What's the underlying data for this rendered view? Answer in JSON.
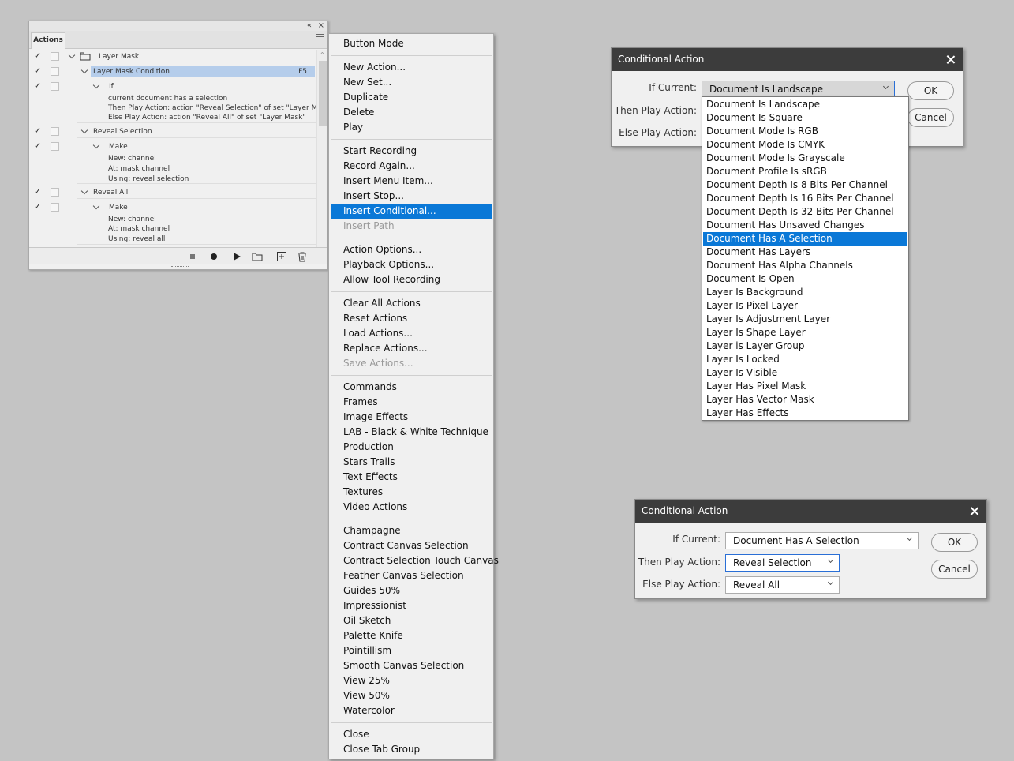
{
  "actions_panel": {
    "tab": "Actions",
    "collapse_glyph": "«",
    "close_glyph": "×",
    "rows": [
      {
        "check": "✓",
        "label": "Layer Mask",
        "icon": "folder-icon"
      },
      {
        "check": "✓",
        "label": "Layer Mask Condition",
        "fkey": "F5",
        "selected": true
      },
      {
        "check": "✓",
        "label": "If"
      },
      {
        "label": "current document has a selection"
      },
      {
        "label": "Then Play Action: action \"Reveal Selection\" of set \"Layer Mask\""
      },
      {
        "label": "Else Play Action: action \"Reveal All\" of set \"Layer Mask\""
      },
      {
        "check": "✓",
        "label": "Reveal Selection"
      },
      {
        "check": "✓",
        "label": "Make"
      },
      {
        "label": "New: channel"
      },
      {
        "label": "At: mask channel"
      },
      {
        "label": "Using: reveal selection"
      },
      {
        "check": "✓",
        "label": "Reveal All"
      },
      {
        "check": "✓",
        "label": "Make"
      },
      {
        "label": "New: channel"
      },
      {
        "label": "At: mask channel"
      },
      {
        "label": "Using: reveal all"
      }
    ],
    "toolbar_icons": [
      "stop-icon",
      "record-icon",
      "play-icon",
      "new-set-icon",
      "new-action-icon",
      "delete-icon"
    ]
  },
  "context_menu": {
    "groups": [
      [
        {
          "label": "Button Mode"
        }
      ],
      [
        {
          "label": "New Action..."
        },
        {
          "label": "New Set..."
        },
        {
          "label": "Duplicate"
        },
        {
          "label": "Delete"
        },
        {
          "label": "Play"
        }
      ],
      [
        {
          "label": "Start Recording"
        },
        {
          "label": "Record Again..."
        },
        {
          "label": "Insert Menu Item..."
        },
        {
          "label": "Insert Stop..."
        },
        {
          "label": "Insert Conditional...",
          "highlighted": true
        },
        {
          "label": "Insert Path",
          "disabled": true
        }
      ],
      [
        {
          "label": "Action Options..."
        },
        {
          "label": "Playback Options..."
        },
        {
          "label": "Allow Tool Recording"
        }
      ],
      [
        {
          "label": "Clear All Actions"
        },
        {
          "label": "Reset Actions"
        },
        {
          "label": "Load Actions..."
        },
        {
          "label": "Replace Actions..."
        },
        {
          "label": "Save Actions...",
          "disabled": true
        }
      ],
      [
        {
          "label": "Commands"
        },
        {
          "label": "Frames"
        },
        {
          "label": "Image Effects"
        },
        {
          "label": "LAB - Black & White Technique"
        },
        {
          "label": "Production"
        },
        {
          "label": "Stars Trails"
        },
        {
          "label": "Text Effects"
        },
        {
          "label": "Textures"
        },
        {
          "label": "Video Actions"
        }
      ],
      [
        {
          "label": "Champagne"
        },
        {
          "label": "Contract Canvas Selection"
        },
        {
          "label": "Contract Selection Touch Canvas"
        },
        {
          "label": "Feather Canvas Selection"
        },
        {
          "label": "Guides 50%"
        },
        {
          "label": "Impressionist"
        },
        {
          "label": "Oil Sketch"
        },
        {
          "label": "Palette Knife"
        },
        {
          "label": "Pointillism"
        },
        {
          "label": "Smooth Canvas Selection"
        },
        {
          "label": "View 25%"
        },
        {
          "label": "View 50%"
        },
        {
          "label": "Watercolor"
        }
      ],
      [
        {
          "label": "Close"
        },
        {
          "label": "Close Tab Group"
        }
      ]
    ]
  },
  "dialog_top": {
    "title": "Conditional Action",
    "if_label": "If Current:",
    "then_label": "Then Play Action:",
    "else_label": "Else Play Action:",
    "if_value": "Document Is Landscape",
    "ok": "OK",
    "cancel": "Cancel",
    "options": [
      "Document Is Landscape",
      "Document Is Square",
      "Document Mode Is RGB",
      "Document Mode Is CMYK",
      "Document Mode Is Grayscale",
      "Document Profile Is sRGB",
      "Document Depth Is 8 Bits Per Channel",
      "Document Depth Is 16 Bits Per Channel",
      "Document Depth Is 32 Bits Per Channel",
      "Document Has Unsaved Changes",
      "Document Has A Selection",
      "Document Has Layers",
      "Document Has Alpha Channels",
      "Document Is Open",
      "Layer Is Background",
      "Layer Is Pixel Layer",
      "Layer Is Adjustment Layer",
      "Layer Is Shape Layer",
      "Layer is Layer Group",
      "Layer Is Locked",
      "Layer Is Visible",
      "Layer Has Pixel Mask",
      "Layer Has Vector Mask",
      "Layer Has Effects"
    ],
    "selected_option": "Document Has A Selection"
  },
  "dialog_bottom": {
    "title": "Conditional Action",
    "if_label": "If Current:",
    "then_label": "Then Play Action:",
    "else_label": "Else Play Action:",
    "if_value": "Document Has A Selection",
    "then_value": "Reveal Selection",
    "else_value": "Reveal All",
    "ok": "OK",
    "cancel": "Cancel"
  },
  "colors": {
    "highlight": "#0a78d7",
    "row_selected": "#b5cdeb",
    "dialog_titlebar": "#3c3c3c",
    "background": "#c4c4c4"
  }
}
